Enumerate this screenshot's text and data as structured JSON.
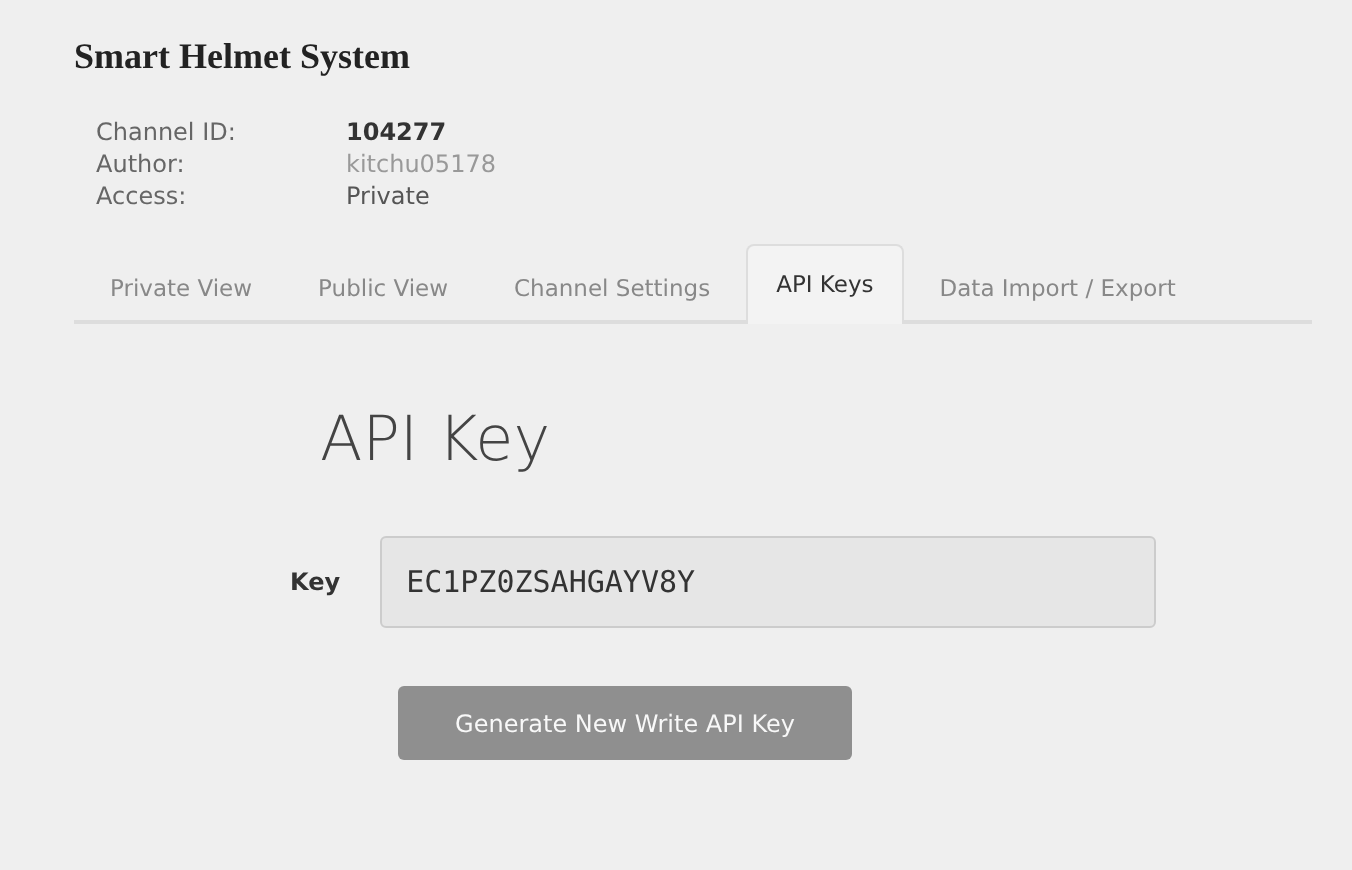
{
  "title": "Smart Helmet System",
  "info": [
    {
      "label": "Channel ID:",
      "value": "104277",
      "kind": "bold"
    },
    {
      "label": "Author:",
      "value": "kitchu05178",
      "kind": "link"
    },
    {
      "label": "Access:",
      "value": "Private",
      "kind": "plain"
    }
  ],
  "tabs": [
    {
      "label": "Private View",
      "selected": false
    },
    {
      "label": "Public View",
      "selected": false
    },
    {
      "label": "Channel Settings",
      "selected": false
    },
    {
      "label": "API Keys",
      "selected": true
    },
    {
      "label": "Data Import / Export",
      "selected": false
    }
  ],
  "heading": "API Key",
  "key_field": {
    "label": "Key",
    "value": "EC1PZ0ZSAHGAYV8Y"
  },
  "button": {
    "label": "Generate New Write API Key",
    "disabled": true
  }
}
